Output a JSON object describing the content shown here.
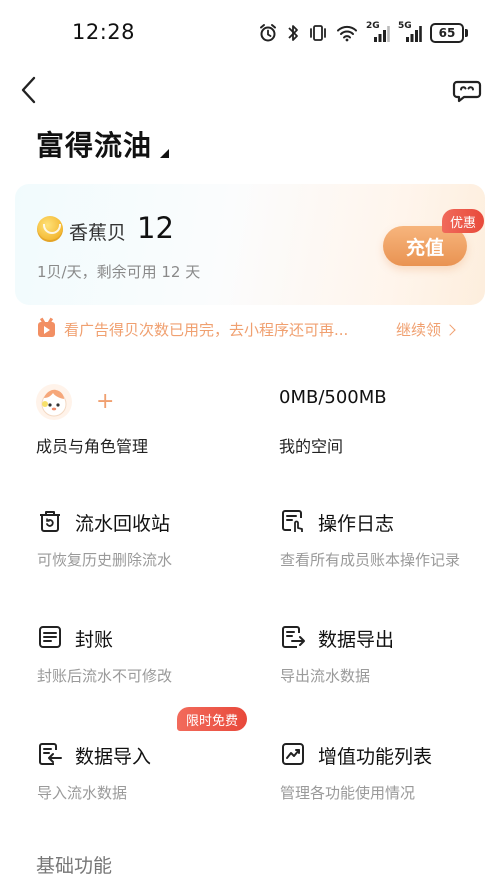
{
  "status_bar": {
    "time": "12:28",
    "battery": "65",
    "icons": [
      "alarm-icon",
      "bluetooth-icon",
      "vibrate-icon",
      "wifi-icon",
      "signal-2g-icon",
      "signal-5g-icon",
      "battery-icon"
    ],
    "signal_2g": "2G",
    "signal_5g": "5G"
  },
  "nav": {
    "back_icon": "chevron-left-icon",
    "service_icon": "customer-service-icon"
  },
  "book": {
    "title": "富得流油"
  },
  "member_card": {
    "coin_label": "香蕉贝",
    "coin_value": "12",
    "desc": "1贝/天，剩余可用 12 天",
    "recharge_label": "充值",
    "badge": "优惠"
  },
  "ad": {
    "text": "看广告得贝次数已用完，去小程序还可再...",
    "action": "继续领"
  },
  "overview": {
    "member_label": "成员与角色管理",
    "plus": "+",
    "storage_value": "0MB/500MB",
    "storage_label": "我的空间"
  },
  "features": [
    {
      "title": "流水回收站",
      "desc": "可恢复历史删除流水",
      "icon": "recycle-bin-icon"
    },
    {
      "title": "操作日志",
      "desc": "查看所有成员账本操作记录",
      "icon": "operation-log-icon"
    },
    {
      "title": "封账",
      "desc": "封账后流水不可修改",
      "icon": "seal-ledger-icon"
    },
    {
      "title": "数据导出",
      "desc": "导出流水数据",
      "icon": "data-export-icon"
    },
    {
      "title": "数据导入",
      "desc": "导入流水数据",
      "icon": "data-import-icon"
    },
    {
      "title": "增值功能列表",
      "desc": "管理各功能使用情况",
      "icon": "value-added-icon"
    }
  ],
  "free_badge": "限时免费",
  "section": {
    "title": "基础功能"
  },
  "colors": {
    "accent": "#e99352",
    "badge_red": "#e84a3b",
    "ad_text": "#f0a070"
  }
}
